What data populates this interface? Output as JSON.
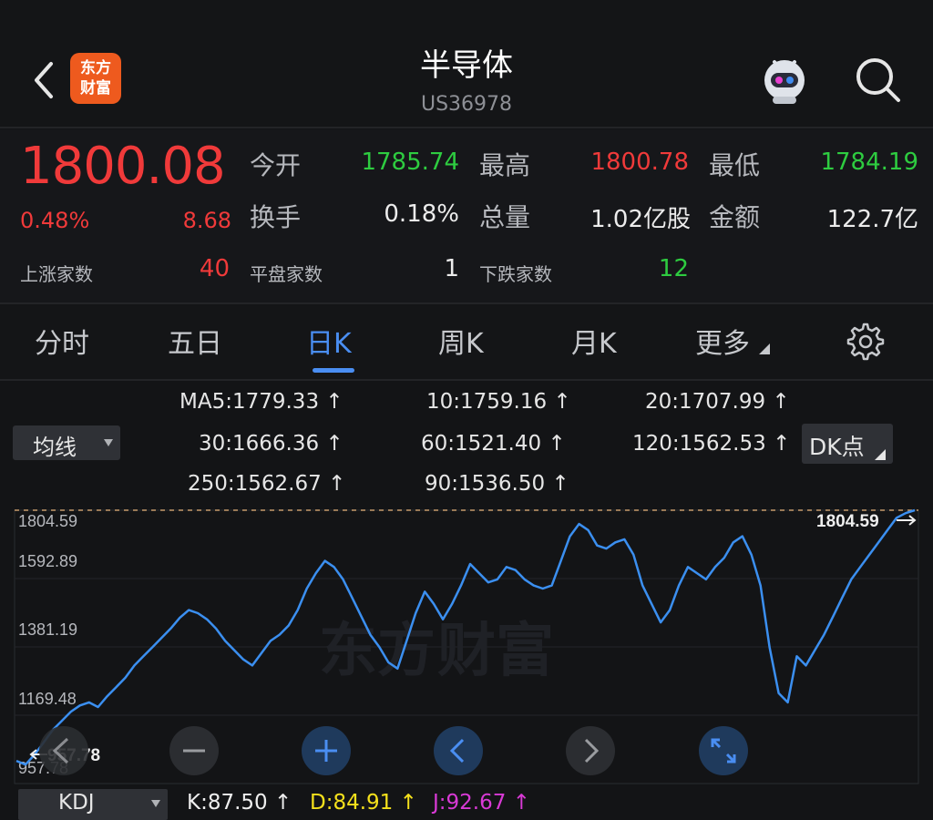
{
  "header": {
    "title": "半导体",
    "code": "US36978",
    "logo_line1": "东方",
    "logo_line2": "财富"
  },
  "quote": {
    "price": "1800.08",
    "change_pct": "0.48%",
    "change": "8.68",
    "stats": [
      {
        "label": "今开",
        "value": "1785.74",
        "color": "#2ecc40"
      },
      {
        "label": "最高",
        "value": "1800.78",
        "color": "#f03a3a"
      },
      {
        "label": "最低",
        "value": "1784.19",
        "color": "#2ecc40"
      },
      {
        "label": "换手",
        "value": "0.18%",
        "color": "#ececec"
      },
      {
        "label": "总量",
        "value": "1.02亿股",
        "color": "#ececec"
      },
      {
        "label": "金额",
        "value": "122.7亿",
        "color": "#ececec"
      }
    ],
    "breadth": [
      {
        "label": "上涨家数",
        "value": "40",
        "color": "#f03a3a"
      },
      {
        "label": "平盘家数",
        "value": "1",
        "color": "#ececec"
      },
      {
        "label": "下跌家数",
        "value": "12",
        "color": "#2ecc40"
      }
    ]
  },
  "tabs": [
    {
      "label": "分时"
    },
    {
      "label": "五日"
    },
    {
      "label": "日K",
      "active": true
    },
    {
      "label": "周K"
    },
    {
      "label": "月K"
    },
    {
      "label": "更多"
    }
  ],
  "ma": {
    "select_label": "均线",
    "dk_label": "DK点",
    "items": [
      {
        "text": "MA5:1779.33 ↑",
        "color": "#eeeeee"
      },
      {
        "text": "10:1759.16 ↑",
        "color": "#f5e11c"
      },
      {
        "text": "20:1707.99 ↑",
        "color": "#d93ad6"
      },
      {
        "text": "30:1666.36 ↑",
        "color": "#2eca3a"
      },
      {
        "text": "60:1521.40 ↑",
        "color": "#cfcfcf"
      },
      {
        "text": "120:1562.53 ↑",
        "color": "#5a6ef0"
      },
      {
        "text": "250:1562.67 ↑",
        "color": "#a8b8f8"
      },
      {
        "text": "90:1536.50 ↑",
        "color": "#e82a2a"
      }
    ]
  },
  "chart_data": {
    "type": "line",
    "yticks": [
      "1804.59",
      "1592.89",
      "1381.19",
      "1169.48",
      "957.78"
    ],
    "ylim": [
      957.78,
      1804.59
    ],
    "high_label": "1804.59",
    "low_label": "957.78",
    "series": [
      {
        "values": [
          990,
          978,
          1010,
          1050,
          1090,
          1120,
          1150,
          1170,
          1180,
          1165,
          1200,
          1230,
          1260,
          1300,
          1330,
          1360,
          1390,
          1420,
          1455,
          1480,
          1470,
          1450,
          1420,
          1380,
          1350,
          1320,
          1300,
          1340,
          1380,
          1400,
          1430,
          1480,
          1550,
          1600,
          1640,
          1620,
          1580,
          1520,
          1460,
          1400,
          1360,
          1310,
          1290,
          1380,
          1470,
          1540,
          1500,
          1450,
          1500,
          1560,
          1630,
          1600,
          1570,
          1580,
          1620,
          1610,
          1580,
          1560,
          1550,
          1560,
          1640,
          1720,
          1760,
          1740,
          1690,
          1680,
          1700,
          1710,
          1660,
          1560,
          1500,
          1440,
          1480,
          1560,
          1620,
          1600,
          1580,
          1620,
          1650,
          1700,
          1720,
          1660,
          1560,
          1360,
          1210,
          1180,
          1330,
          1300,
          1350,
          1400,
          1460,
          1520,
          1580,
          1620,
          1660,
          1700,
          1740,
          1780,
          1795,
          1804.59
        ]
      }
    ]
  },
  "kdj": {
    "select_label": "KDJ",
    "k": "K:87.50 ↑",
    "d": "D:84.91 ↑",
    "j": "J:92.67 ↑"
  }
}
